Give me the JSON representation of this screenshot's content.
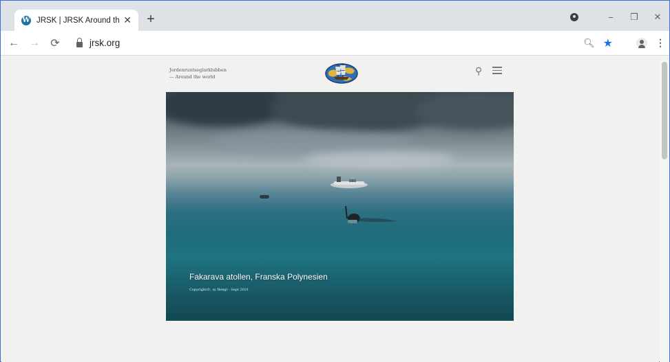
{
  "browser": {
    "tab": {
      "title": "JRSK | JRSK Around the world",
      "favicon": "wordpress-icon"
    },
    "address_bar": {
      "url": "jrsk.org"
    },
    "accent_color": "#1a73e8"
  },
  "site": {
    "name_line1": "Jordenruntseglarklubben",
    "name_line2": "— Around the world",
    "logo": "jrsk-ship-globe-logo"
  },
  "hero": {
    "caption": "Fakarava atollen, Franska Polynesien",
    "copyright": "Copyright©, sy Bengt - Sept 2021"
  }
}
